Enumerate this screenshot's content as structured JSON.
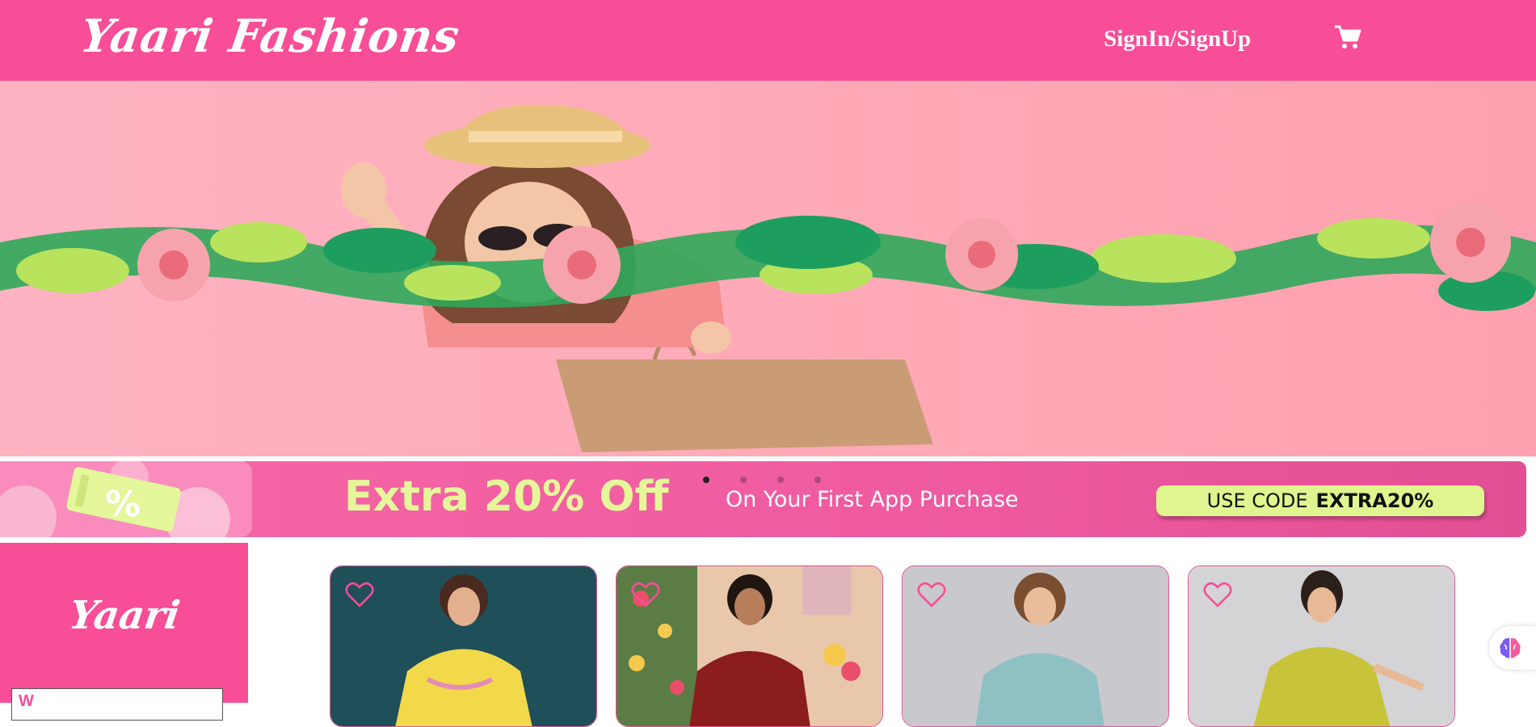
{
  "header": {
    "brand": "Yaari Fashions",
    "signin_label": "SignIn/SignUp",
    "cart_icon": "shopping-cart-icon"
  },
  "promo": {
    "headline": "Extra 20% Off",
    "subline": "On Your First App Purchase",
    "code_prefix": "USE CODE",
    "code": "EXTRA20%",
    "tag_symbol": "%"
  },
  "carousel": {
    "slide_count": 4,
    "active_slide": 1
  },
  "sidebar": {
    "brand": "Yaari",
    "input_value": "W"
  },
  "products": [
    {
      "name": "product-card-1",
      "bg": "#1f4f59",
      "dress": "#f2d94a",
      "wishlist_icon": "heart-icon"
    },
    {
      "name": "product-card-2",
      "bg": "#e9c7aa",
      "dress": "#8b1d1d",
      "wishlist_icon": "heart-icon"
    },
    {
      "name": "product-card-3",
      "bg": "#c9c9cd",
      "dress": "#8fc1c4",
      "wishlist_icon": "heart-icon"
    },
    {
      "name": "product-card-4",
      "bg": "#d4d4d6",
      "dress": "#c8c43a",
      "wishlist_icon": "heart-icon"
    }
  ],
  "colors": {
    "brand_pink": "#f84d97",
    "promo_green": "#dff58f"
  }
}
